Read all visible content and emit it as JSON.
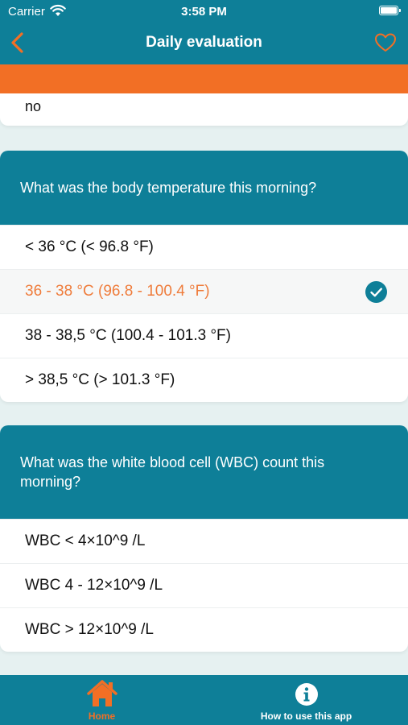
{
  "status": {
    "carrier": "Carrier",
    "time": "3:58 PM"
  },
  "nav": {
    "title": "Daily evaluation"
  },
  "previous_answer": "no",
  "questions": [
    {
      "text": "What was the body temperature this morning?",
      "options": [
        "< 36 °C (< 96.8 °F)",
        "36 - 38 °C (96.8 - 100.4 °F)",
        "38 - 38,5 °C (100.4 - 101.3 °F)",
        "> 38,5 °C (> 101.3 °F)"
      ],
      "selected_index": 1
    },
    {
      "text": "What was the white blood cell (WBC) count this morning?",
      "options": [
        "WBC < 4×10^9 /L",
        "WBC 4 - 12×10^9 /L",
        "WBC > 12×10^9 /L"
      ],
      "selected_index": null
    }
  ],
  "tabs": [
    {
      "label": "Home",
      "icon": "home-icon",
      "active": true
    },
    {
      "label": "How to use this app",
      "icon": "info-icon",
      "active": false
    }
  ],
  "colors": {
    "primary": "#0e7f98",
    "accent": "#f26f25",
    "selected_text": "#ef7c3b",
    "background": "#e6f1f1"
  }
}
